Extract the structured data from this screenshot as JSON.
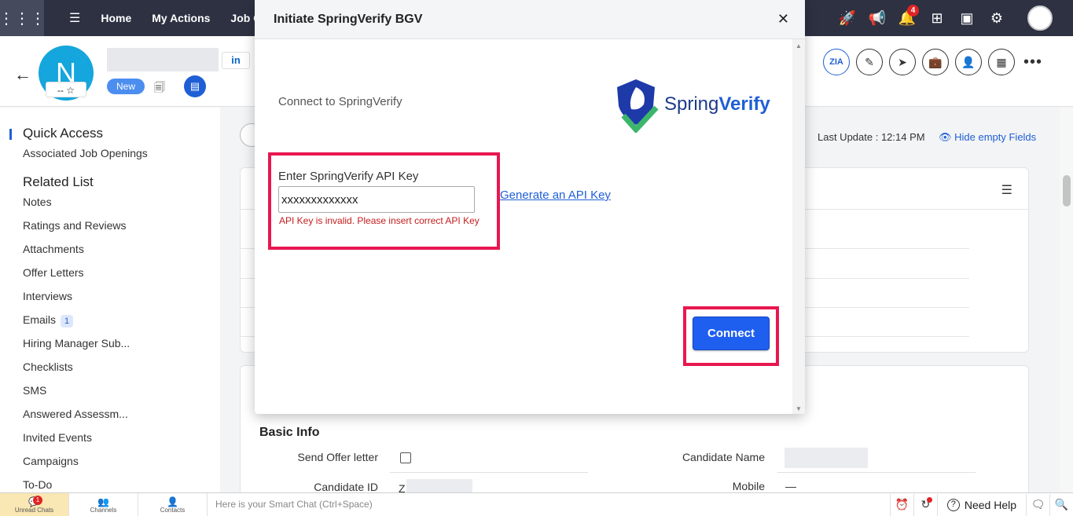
{
  "topbar": {
    "nav": [
      "Home",
      "My Actions",
      "Job Op"
    ],
    "notification_count": "4"
  },
  "candidate": {
    "avatar_letter": "N",
    "rating": "-- ☆",
    "linkedin": "in",
    "status_badge": "New"
  },
  "sidebar": {
    "quick_access_heading": "Quick Access",
    "quick_access_items": [
      "Associated Job Openings"
    ],
    "related_list_heading": "Related List",
    "related_items": [
      {
        "label": "Notes"
      },
      {
        "label": "Ratings and Reviews"
      },
      {
        "label": "Attachments"
      },
      {
        "label": "Offer Letters"
      },
      {
        "label": "Interviews"
      },
      {
        "label": "Emails",
        "badge": "1"
      },
      {
        "label": "Hiring Manager Sub..."
      },
      {
        "label": "Checklists"
      },
      {
        "label": "SMS"
      },
      {
        "label": "Answered Assessm..."
      },
      {
        "label": "Invited Events"
      },
      {
        "label": "Campaigns"
      },
      {
        "label": "To-Do"
      }
    ]
  },
  "main": {
    "last_update": "Last Update : 12:14 PM",
    "hide_empty": "Hide empty Fields",
    "basic_info_heading": "Basic Info",
    "fields": {
      "send_offer_letter": "Send Offer letter",
      "candidate_name": "Candidate Name",
      "candidate_id": "Candidate ID",
      "candidate_id_value": "Z",
      "mobile": "Mobile",
      "mobile_value": "—"
    }
  },
  "modal": {
    "title": "Initiate SpringVerify BGV",
    "connect_to": "Connect to SpringVerify",
    "logo_text_1": "Spring",
    "logo_text_2": "Verify",
    "api_key_label": "Enter SpringVerify API Key",
    "api_key_value": "xxxxxxxxxxxxx",
    "api_error": "API Key is invalid. Please insert correct API Key",
    "generate_link": "Generate an API Key",
    "connect_button": "Connect"
  },
  "bottombar": {
    "tabs": [
      {
        "label": "Unread Chats",
        "badge": "1"
      },
      {
        "label": "Channels"
      },
      {
        "label": "Contacts"
      }
    ],
    "smart_chat_placeholder": "Here is your Smart Chat (Ctrl+Space)",
    "need_help": "Need Help"
  },
  "colors": {
    "topbar_bg": "#2d3142",
    "accent": "#1f5fd6",
    "highlight_border": "#e8174f",
    "error": "#c41d1d",
    "avatar_bg": "#14a6dc"
  }
}
